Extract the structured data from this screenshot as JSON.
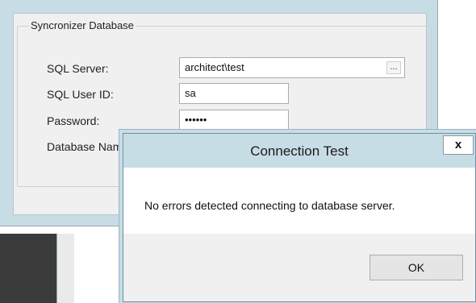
{
  "group": {
    "title": "Syncronizer Database"
  },
  "fields": {
    "sql_server": {
      "label": "SQL Server:",
      "value": "architect\\test",
      "browse": "..."
    },
    "sql_user_id": {
      "label": "SQL User ID:",
      "value": "sa"
    },
    "password": {
      "label": "Password:",
      "value": "••••••"
    },
    "database_name": {
      "label": "Database Nam"
    }
  },
  "dialog": {
    "title": "Connection Test",
    "close_label": "x",
    "message": "No errors detected connecting to database server.",
    "ok_label": "OK"
  }
}
